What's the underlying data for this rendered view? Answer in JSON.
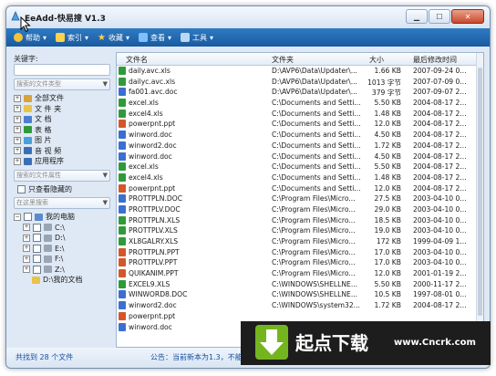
{
  "window": {
    "title": "EeAdd-快易搜 V1.3",
    "caption_buttons": [
      "minimize",
      "maximize",
      "close"
    ]
  },
  "menu": [
    {
      "label": "帮助",
      "icon": "help-icon",
      "color": "#f2c23b"
    },
    {
      "label": "索引",
      "icon": "index-icon",
      "color": "#ffd24a"
    },
    {
      "label": "收藏",
      "icon": "star-icon",
      "color": "#ffd24a"
    },
    {
      "label": "查看",
      "icon": "view-icon",
      "color": "#7ec0ff"
    },
    {
      "label": "工具",
      "icon": "tools-icon",
      "color": "#bcd7f0"
    }
  ],
  "sidebar": {
    "keyword_label": "关键字:",
    "keyword_value": "",
    "type_combo": "搜索的文件类型",
    "types": [
      {
        "label": "全部文件",
        "color": "#d8a23c"
      },
      {
        "label": "文 件 夹",
        "color": "#e8c34a"
      },
      {
        "label": "文    档",
        "color": "#4c7fd0"
      },
      {
        "label": "表    格",
        "color": "#2f9a3a"
      },
      {
        "label": "图    片",
        "color": "#4aa0d8"
      },
      {
        "label": "音 视 频",
        "color": "#3b6fb5"
      },
      {
        "label": "应用程序",
        "color": "#3a6fb5"
      }
    ],
    "attr_combo": "搜索的文件属性",
    "hidden_only_label": "只查看隐藏的",
    "location_combo": "在这里搜索",
    "tree": {
      "root": "我的电脑",
      "drives": [
        "C:\\",
        "D:\\",
        "E:\\",
        "F:\\",
        "Z:\\"
      ],
      "docs": "D:\\我的文档"
    }
  },
  "table": {
    "headers": {
      "name": "文件名",
      "folder": "文件夹",
      "size": "大小",
      "modified": "最后修改时间"
    },
    "rows": [
      {
        "name": "daily.avc.xls",
        "folder": "D:\\AVP6\\Data\\Updater\\...",
        "size": "1.66 KB",
        "date": "2007-09-24 0...",
        "type": "xls"
      },
      {
        "name": "dailyc.avc.xls",
        "folder": "D:\\AVP6\\Data\\Updater\\...",
        "size": "1013 字节",
        "date": "2007-07-09 0...",
        "type": "xls"
      },
      {
        "name": "fa001.avc.doc",
        "folder": "D:\\AVP6\\Data\\Updater\\...",
        "size": "379 字节",
        "date": "2007-09-07 2...",
        "type": "doc"
      },
      {
        "name": "excel.xls",
        "folder": "C:\\Documents and Setti...",
        "size": "5.50 KB",
        "date": "2004-08-17 2...",
        "type": "xls"
      },
      {
        "name": "excel4.xls",
        "folder": "C:\\Documents and Setti...",
        "size": "1.48 KB",
        "date": "2004-08-17 2...",
        "type": "xls"
      },
      {
        "name": "powerpnt.ppt",
        "folder": "C:\\Documents and Setti...",
        "size": "12.0 KB",
        "date": "2004-08-17 2...",
        "type": "ppt"
      },
      {
        "name": "winword.doc",
        "folder": "C:\\Documents and Setti...",
        "size": "4.50 KB",
        "date": "2004-08-17 2...",
        "type": "doc"
      },
      {
        "name": "winword2.doc",
        "folder": "C:\\Documents and Setti...",
        "size": "1.72 KB",
        "date": "2004-08-17 2...",
        "type": "doc"
      },
      {
        "name": "winword.doc",
        "folder": "C:\\Documents and Setti...",
        "size": "4.50 KB",
        "date": "2004-08-17 2...",
        "type": "doc"
      },
      {
        "name": "excel.xls",
        "folder": "C:\\Documents and Setti...",
        "size": "5.50 KB",
        "date": "2004-08-17 2...",
        "type": "xls"
      },
      {
        "name": "excel4.xls",
        "folder": "C:\\Documents and Setti...",
        "size": "1.48 KB",
        "date": "2004-08-17 2...",
        "type": "xls"
      },
      {
        "name": "powerpnt.ppt",
        "folder": "C:\\Documents and Setti...",
        "size": "12.0 KB",
        "date": "2004-08-17 2...",
        "type": "ppt"
      },
      {
        "name": "PROTTPLN.DOC",
        "folder": "C:\\Program Files\\Micro...",
        "size": "27.5 KB",
        "date": "2003-04-10 0...",
        "type": "doc"
      },
      {
        "name": "PROTTPLV.DOC",
        "folder": "C:\\Program Files\\Micro...",
        "size": "29.0 KB",
        "date": "2003-04-10 0...",
        "type": "doc"
      },
      {
        "name": "PROTTPLN.XLS",
        "folder": "C:\\Program Files\\Micro...",
        "size": "18.5 KB",
        "date": "2003-04-10 0...",
        "type": "xls"
      },
      {
        "name": "PROTTPLV.XLS",
        "folder": "C:\\Program Files\\Micro...",
        "size": "19.0 KB",
        "date": "2003-04-10 0...",
        "type": "xls"
      },
      {
        "name": "XL8GALRY.XLS",
        "folder": "C:\\Program Files\\Micro...",
        "size": "172 KB",
        "date": "1999-04-09 1...",
        "type": "xls"
      },
      {
        "name": "PROTTPLN.PPT",
        "folder": "C:\\Program Files\\Micro...",
        "size": "17.0 KB",
        "date": "2003-04-10 0...",
        "type": "ppt"
      },
      {
        "name": "PROTTPLV.PPT",
        "folder": "C:\\Program Files\\Micro...",
        "size": "17.0 KB",
        "date": "2003-04-10 0...",
        "type": "ppt"
      },
      {
        "name": "QUIKANIM.PPT",
        "folder": "C:\\Program Files\\Micro...",
        "size": "12.0 KB",
        "date": "2001-01-19 2...",
        "type": "ppt"
      },
      {
        "name": "EXCEL9.XLS",
        "folder": "C:\\WINDOWS\\SHELLNE...",
        "size": "5.50 KB",
        "date": "2000-11-17 2...",
        "type": "xls"
      },
      {
        "name": "WINWORD8.DOC",
        "folder": "C:\\WINDOWS\\SHELLNE...",
        "size": "10.5 KB",
        "date": "1997-08-01 0...",
        "type": "doc"
      },
      {
        "name": "winword2.doc",
        "folder": "C:\\WINDOWS\\system32...",
        "size": "1.72 KB",
        "date": "2004-08-17 2...",
        "type": "doc"
      },
      {
        "name": "powerpnt.ppt",
        "folder": "",
        "size": "",
        "date": "",
        "type": "ppt"
      },
      {
        "name": "winword.doc",
        "folder": "",
        "size": "",
        "date": "",
        "type": "doc"
      }
    ]
  },
  "status": {
    "found": "共找到 28 个文件",
    "notice": "公告：当前新本为1.3，不能"
  },
  "banner": {
    "text": "起点下载",
    "url": "www.Cncrk.com"
  },
  "colors": {
    "xls": "#2f9a3a",
    "doc": "#3b6fd0",
    "ppt": "#d2572a",
    "accent": "#1d5fa8"
  }
}
